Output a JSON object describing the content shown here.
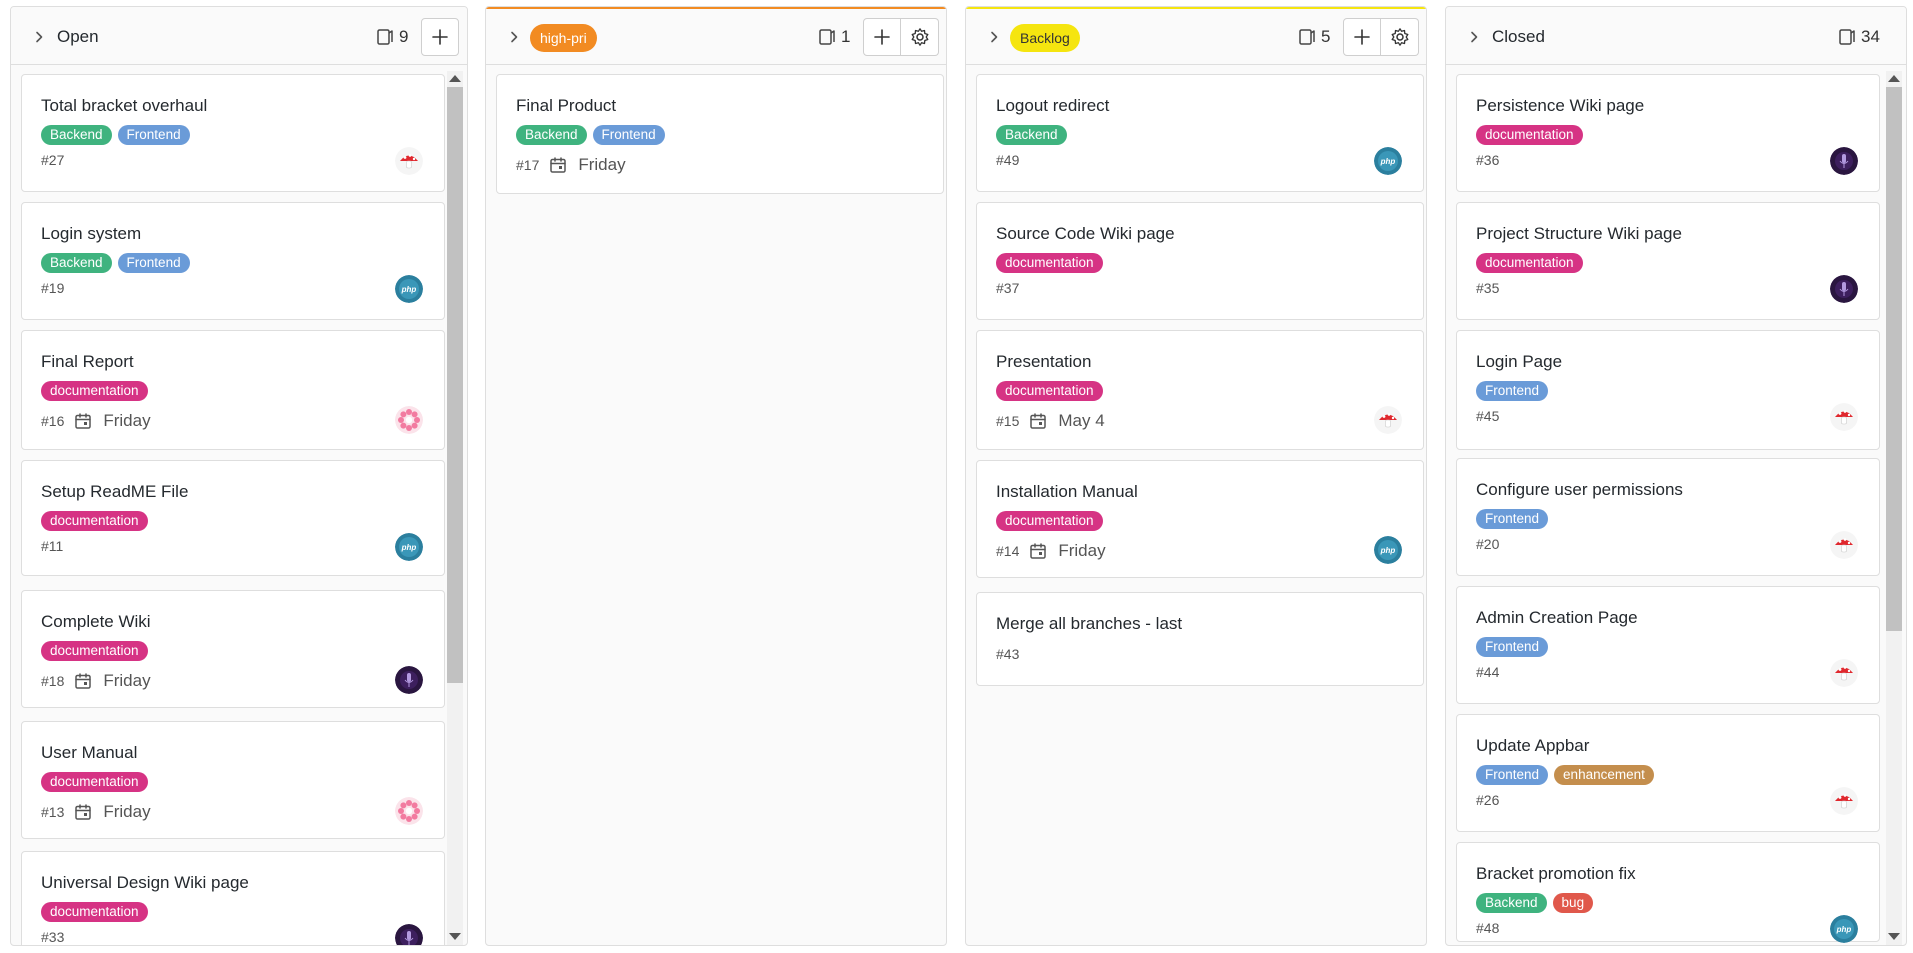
{
  "colors": {
    "backend": "#3fb37f",
    "frontend": "#6a9bd8",
    "documentation": "#d63384",
    "enhancement": "#c48e4d",
    "bug": "#e0584b",
    "high_pri": "#f28b22",
    "backlog": "#f5e50f"
  },
  "columns": [
    {
      "title": "Open",
      "count": "9",
      "cards": [
        {
          "title": "Total bracket overhaul",
          "labels": [
            "Backend",
            "Frontend"
          ],
          "number": "#27",
          "due": "",
          "avatar": "mushroom-avatar"
        },
        {
          "title": "Login system",
          "labels": [
            "Backend",
            "Frontend"
          ],
          "number": "#19",
          "due": "",
          "avatar": "php-avatar"
        },
        {
          "title": "Final Report",
          "labels": [
            "documentation"
          ],
          "number": "#16",
          "due": "Friday",
          "avatar": "flower-avatar"
        },
        {
          "title": "Setup ReadME File",
          "labels": [
            "documentation"
          ],
          "number": "#11",
          "due": "",
          "avatar": "php-avatar"
        },
        {
          "title": "Complete Wiki",
          "labels": [
            "documentation"
          ],
          "number": "#18",
          "due": "Friday",
          "avatar": "mic-avatar"
        },
        {
          "title": "User Manual",
          "labels": [
            "documentation"
          ],
          "number": "#13",
          "due": "Friday",
          "avatar": "flower-avatar"
        },
        {
          "title": "Universal Design Wiki page",
          "labels": [
            "documentation"
          ],
          "number": "#33",
          "due": "",
          "avatar": "mic-avatar"
        }
      ]
    },
    {
      "title": "high-pri",
      "count": "1",
      "cards": [
        {
          "title": "Final Product",
          "labels": [
            "Backend",
            "Frontend"
          ],
          "number": "#17",
          "due": "Friday",
          "avatar": ""
        }
      ]
    },
    {
      "title": "Backlog",
      "count": "5",
      "cards": [
        {
          "title": "Logout redirect",
          "labels": [
            "Backend"
          ],
          "number": "#49",
          "due": "",
          "avatar": "php-avatar"
        },
        {
          "title": "Source Code Wiki page",
          "labels": [
            "documentation"
          ],
          "number": "#37",
          "due": "",
          "avatar": ""
        },
        {
          "title": "Presentation",
          "labels": [
            "documentation"
          ],
          "number": "#15",
          "due": "May 4",
          "avatar": "mushroom-avatar"
        },
        {
          "title": "Installation Manual",
          "labels": [
            "documentation"
          ],
          "number": "#14",
          "due": "Friday",
          "avatar": "php-avatar"
        },
        {
          "title": "Merge all branches - last",
          "labels": [],
          "number": "#43",
          "due": "",
          "avatar": ""
        }
      ]
    },
    {
      "title": "Closed",
      "count": "34",
      "cards": [
        {
          "title": "Persistence Wiki page",
          "labels": [
            "documentation"
          ],
          "number": "#36",
          "due": "",
          "avatar": "mic-avatar"
        },
        {
          "title": "Project Structure Wiki page",
          "labels": [
            "documentation"
          ],
          "number": "#35",
          "due": "",
          "avatar": "mic-avatar"
        },
        {
          "title": "Login Page",
          "labels": [
            "Frontend"
          ],
          "number": "#45",
          "due": "",
          "avatar": "mushroom-avatar"
        },
        {
          "title": "Configure user permissions",
          "labels": [
            "Frontend"
          ],
          "number": "#20",
          "due": "",
          "avatar": "mushroom-avatar"
        },
        {
          "title": "Admin Creation Page",
          "labels": [
            "Frontend"
          ],
          "number": "#44",
          "due": "",
          "avatar": "mushroom-avatar"
        },
        {
          "title": "Update Appbar",
          "labels": [
            "Frontend",
            "enhancement"
          ],
          "number": "#26",
          "due": "",
          "avatar": "mushroom-avatar"
        },
        {
          "title": "Bracket promotion fix",
          "labels": [
            "Backend",
            "bug"
          ],
          "number": "#48",
          "due": "",
          "avatar": "php-avatar"
        }
      ]
    }
  ]
}
